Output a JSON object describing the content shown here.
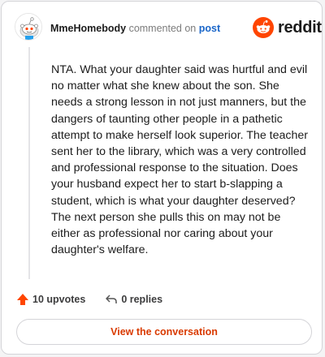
{
  "header": {
    "username": "MmeHomebody",
    "action_text": "commented on",
    "post_link": "post",
    "brand": "reddit"
  },
  "comment": {
    "body": "NTA. What your daughter said was hurtful and evil no matter what she knew about the son. She needs a strong lesson in not just manners, but the dangers of taunting other people in a pathetic attempt to make herself look superior. The teacher sent her to the library, which was a very controlled and professional response to the situation. Does your husband expect her to start b-slapping a student, which is what your daughter deserved? The next person she pulls this on may not be either as professional nor caring about your daughter's welfare."
  },
  "actions": {
    "upvotes": "10 upvotes",
    "replies": "0 replies"
  },
  "footer": {
    "button_label": "View the conversation"
  },
  "colors": {
    "brand_orange": "#ff4500",
    "link_blue": "#1a66c9",
    "button_text": "#d93a00"
  }
}
